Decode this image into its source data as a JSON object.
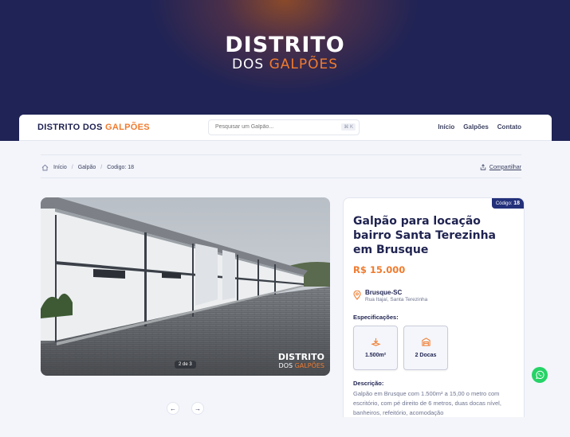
{
  "hero": {
    "logo_line1": "DISTRITO",
    "logo_line2_a": "DOS ",
    "logo_line2_b": "GALPÕES"
  },
  "header": {
    "brand_a": "DISTRITO DOS ",
    "brand_b": "GALPÕES",
    "search_placeholder": "Pesquisar um Galpão...",
    "search_shortcut": "⌘ K",
    "nav": [
      "Início",
      "Galpões",
      "Contato"
    ]
  },
  "breadcrumb": {
    "items": [
      "Início",
      "Galpão",
      "Codigo: 18"
    ],
    "share_label": "Compartilhar"
  },
  "gallery": {
    "counter": "2 de 3",
    "watermark_line1": "DISTRITO",
    "watermark_line2_a": "DOS ",
    "watermark_line2_b": "GALPÕES",
    "prev_label": "←",
    "next_label": "→"
  },
  "listing": {
    "code_label": "Código: ",
    "code_value": "18",
    "title": "Galpão para locação bairro Santa Terezinha em Brusque",
    "price": "R$ 15.000",
    "city": "Brusque-SC",
    "address": "Rua Itajaí, Santa Terezinha",
    "specs_heading": "Especificações:",
    "specs": [
      {
        "icon": "area-icon",
        "label": "1.500m²"
      },
      {
        "icon": "dock-icon",
        "label": "2 Docas"
      }
    ],
    "description_heading": "Descrição:",
    "description": "Galpão em Brusque com 1.500m² a 15,00 o metro com escritório, com pé direito de 6 metros, duas docas nível, banheiros, refeitório, acomodação"
  },
  "colors": {
    "accent": "#f07b2e",
    "navy": "#1f2350",
    "badge": "#23307a",
    "whatsapp": "#25d366"
  },
  "floating": {
    "icon": "whatsapp-icon"
  }
}
